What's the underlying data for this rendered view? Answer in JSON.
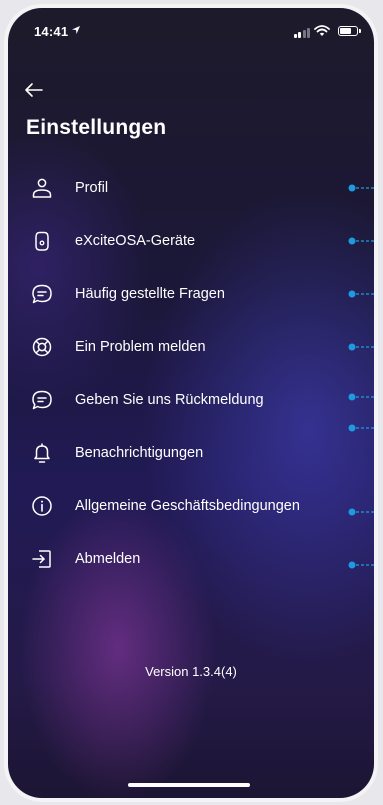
{
  "status_bar": {
    "time": "14:41",
    "battery_level": 0.7
  },
  "header": {
    "title": "Einstellungen"
  },
  "menu": {
    "items": [
      {
        "label": "Profil",
        "icon": "user-icon",
        "conn": 0
      },
      {
        "label": "eXciteOSA-Geräte",
        "icon": "device-icon",
        "conn": 0
      },
      {
        "label": "Häufig gestellte Fragen",
        "icon": "chat-bubble-icon",
        "conn": 0
      },
      {
        "label": "Ein Problem melden",
        "icon": "lifebuoy-icon",
        "conn": 0
      },
      {
        "label": "Geben Sie uns Rückmeldung",
        "icon": "feedback-bubble-icon",
        "conn": 0
      },
      {
        "label": "Benachrichtigungen",
        "icon": "bell-icon",
        "conn": 0
      },
      {
        "label": "Allgemeine Geschäftsbedingungen",
        "icon": "info-icon",
        "conn": 0
      },
      {
        "label": "Abmelden",
        "icon": "logout-icon",
        "conn": 0
      }
    ]
  },
  "footer": {
    "version": "Version 1.3.4(4)"
  },
  "colors": {
    "annotation": "#1e9be0",
    "text": "#ffffff"
  }
}
